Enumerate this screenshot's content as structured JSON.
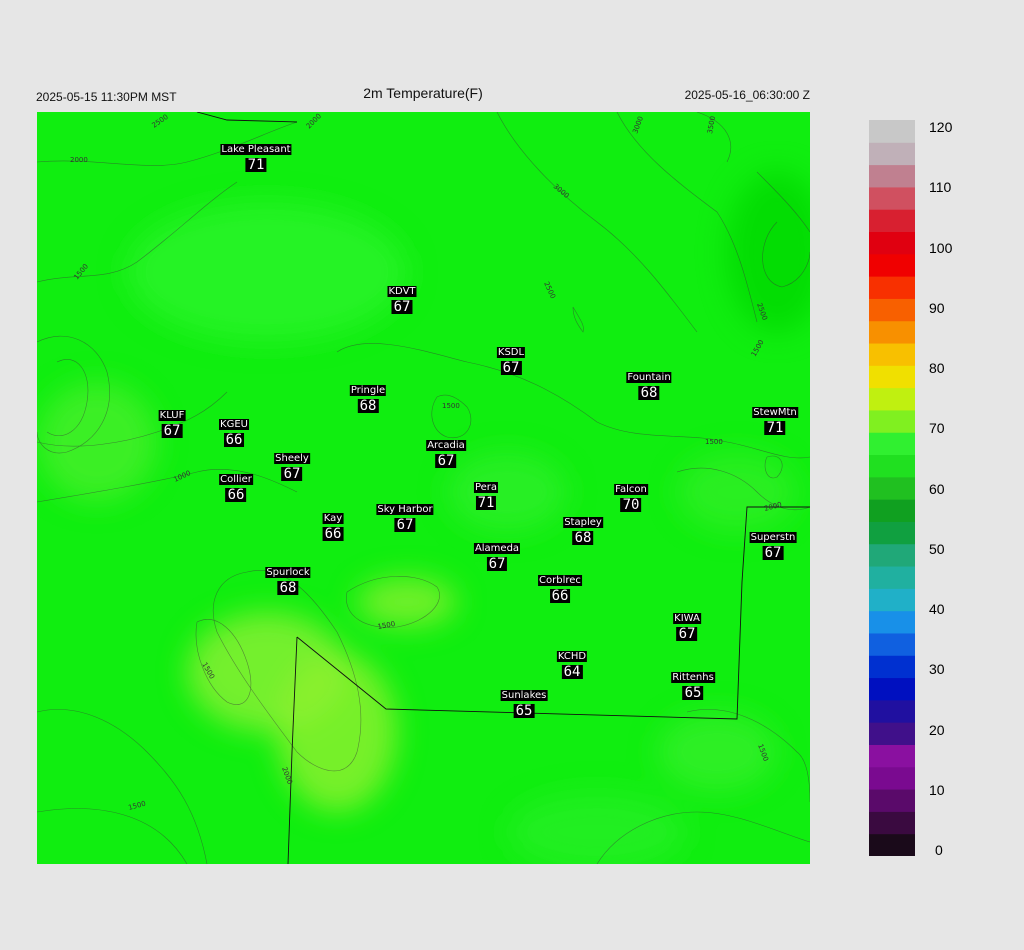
{
  "header": {
    "left_time": "2025-05-15 11:30PM MST",
    "title": "2m Temperature(F)",
    "right_time": "2025-05-16_06:30:00 Z"
  },
  "stations": [
    {
      "name": "Lake Pleasant",
      "value": "71"
    },
    {
      "name": "KDVT",
      "value": "67"
    },
    {
      "name": "KSDL",
      "value": "67"
    },
    {
      "name": "Fountain",
      "value": "68"
    },
    {
      "name": "Pringle",
      "value": "68"
    },
    {
      "name": "StewMtn",
      "value": "71"
    },
    {
      "name": "KLUF",
      "value": "67"
    },
    {
      "name": "KGEU",
      "value": "66"
    },
    {
      "name": "Arcadia",
      "value": "67"
    },
    {
      "name": "Sheely",
      "value": "67"
    },
    {
      "name": "Collier",
      "value": "66"
    },
    {
      "name": "Pera",
      "value": "71"
    },
    {
      "name": "Falcon",
      "value": "70"
    },
    {
      "name": "Kay",
      "value": "66"
    },
    {
      "name": "Sky Harbor",
      "value": "67"
    },
    {
      "name": "Stapley",
      "value": "68"
    },
    {
      "name": "Superstn",
      "value": "67"
    },
    {
      "name": "Alameda",
      "value": "67"
    },
    {
      "name": "Spurlock",
      "value": "68"
    },
    {
      "name": "Corblrec",
      "value": "66"
    },
    {
      "name": "KIWA",
      "value": "67"
    },
    {
      "name": "KCHD",
      "value": "64"
    },
    {
      "name": "Rittenhs",
      "value": "65"
    },
    {
      "name": "Sunlakes",
      "value": "65"
    }
  ],
  "contour_labels": [
    "2500",
    "2000",
    "2000",
    "3000",
    "3500",
    "3000",
    "2500",
    "2500",
    "2000",
    "1500",
    "1500",
    "1500",
    "1500",
    "1000",
    "2000",
    "1500",
    "1500",
    "2000",
    "1500",
    "1500"
  ],
  "colorbar": {
    "ticks": [
      "120",
      "110",
      "100",
      "90",
      "80",
      "70",
      "60",
      "50",
      "40",
      "30",
      "20",
      "10",
      "0"
    ],
    "min": 0,
    "max": 120,
    "colors": [
      "#1a0a1a",
      "#3a0a40",
      "#5a0a6a",
      "#7a0a90",
      "#8a10a0",
      "#40108a",
      "#2010a0",
      "#0010c0",
      "#0030d0",
      "#1060e0",
      "#1890e8",
      "#20b0c8",
      "#20b0a0",
      "#20a878",
      "#10a040",
      "#10a020",
      "#20c020",
      "#20e020",
      "#30f030",
      "#80f020",
      "#c0f010",
      "#f0e000",
      "#f8c000",
      "#f89000",
      "#f86000",
      "#f83000",
      "#f00000",
      "#e00010",
      "#d82030",
      "#d05060",
      "#c08090",
      "#c0b0b8",
      "#c8c8c8"
    ]
  }
}
